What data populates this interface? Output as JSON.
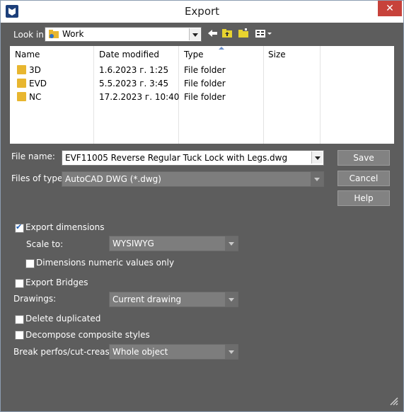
{
  "window": {
    "title": "Export"
  },
  "lookin": {
    "label": "Look in:",
    "value": "Work"
  },
  "filelist": {
    "columns": [
      "Name",
      "Date modified",
      "Type",
      "Size"
    ],
    "rows": [
      {
        "name": "3D",
        "date": "1.6.2023 г. 1:25",
        "type": "File folder",
        "size": ""
      },
      {
        "name": "EVD",
        "date": "5.5.2023 г. 3:45",
        "type": "File folder",
        "size": ""
      },
      {
        "name": "NC",
        "date": "17.2.2023 г. 10:40",
        "type": "File folder",
        "size": ""
      }
    ]
  },
  "filename": {
    "label": "File name:",
    "value": "EVF11005 Reverse Regular Tuck Lock with Legs.dwg"
  },
  "filetype": {
    "label": "Files of type:",
    "value": "AutoCAD DWG (*.dwg)"
  },
  "buttons": {
    "save": "Save",
    "cancel": "Cancel",
    "help": "Help"
  },
  "options": {
    "export_dimensions": {
      "label": "Export dimensions",
      "checked": true
    },
    "scale_to": {
      "label": "Scale to:",
      "value": "WYSIWYG"
    },
    "dims_numeric": {
      "label": "Dimensions numeric values only",
      "checked": false
    },
    "export_bridges": {
      "label": "Export Bridges",
      "checked": false
    },
    "drawings": {
      "label": "Drawings:",
      "value": "Current drawing"
    },
    "delete_dup": {
      "label": "Delete duplicated",
      "checked": false
    },
    "decompose": {
      "label": "Decompose composite styles",
      "checked": false
    },
    "break_perfos": {
      "label": "Break perfos/cut-creases:",
      "value": "Whole object"
    }
  },
  "colors": {
    "dialog_bg": "#5d5d5d",
    "close": "#c7423b",
    "check": "#1f5fb5",
    "folder": "#e8b62f"
  }
}
